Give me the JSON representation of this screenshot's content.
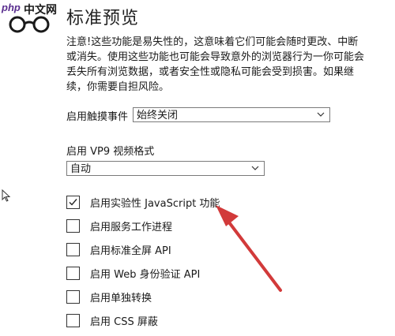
{
  "watermark": {
    "brand_prefix": "php",
    "brand_suffix": "中文网"
  },
  "page": {
    "title": "标准预览"
  },
  "warning_text": "注意!这些功能是易失性的，这意味着它们可能会随时更改、中断或消失。使用这些功能也可能会导致意外的浏览器行为一你可能会丢失所有浏览数据，或者安全性或隐私可能会受到损害。如果继续，你需要自担风险。",
  "touch_events": {
    "label": "启用触摸事件",
    "selected": "始终关闭"
  },
  "vp9": {
    "label": "启用 VP9 视频格式",
    "selected": "自动"
  },
  "checkboxes": [
    {
      "label": "启用实验性 JavaScript 功能",
      "checked": true
    },
    {
      "label": "启用服务工作进程",
      "checked": false
    },
    {
      "label": "启用标准全屏 API",
      "checked": false
    },
    {
      "label": "启用 Web 身份验证 API",
      "checked": false
    },
    {
      "label": "启用单独转换",
      "checked": false
    },
    {
      "label": "启用 CSS 屏蔽",
      "checked": false
    }
  ],
  "colors": {
    "arrow": "#d23a3a",
    "brand": "#5a2e8f"
  },
  "icons": {
    "dropdown": "chevron-down-icon",
    "check": "checkmark-icon",
    "cursor": "mouse-pointer-icon"
  }
}
